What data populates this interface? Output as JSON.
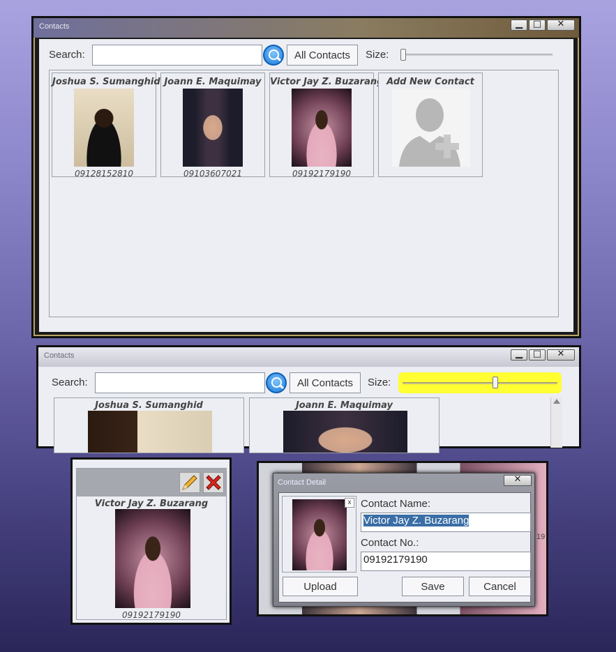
{
  "main_window": {
    "title": "Contacts",
    "search_label": "Search:",
    "search_value": "",
    "filter_button": "All Contacts",
    "size_label": "Size:",
    "size_level": 0.0,
    "contacts": [
      {
        "name": "Joshua S. Sumanghid",
        "number": "09128152810"
      },
      {
        "name": "Joann E. Maquimay",
        "number": "09103607021"
      },
      {
        "name": "Victor Jay Z. Buzarang",
        "number": "09192179190"
      }
    ],
    "add_new_label": "Add New Contact"
  },
  "zoom_window": {
    "title": "Contacts",
    "search_label": "Search:",
    "filter_button": "All Contacts",
    "size_label": "Size:",
    "size_level": 0.6,
    "contacts": [
      {
        "name": "Joshua S. Sumanghid"
      },
      {
        "name": "Joann E. Maquimay"
      }
    ]
  },
  "selected_card": {
    "name": "Victor Jay Z. Buzarang",
    "number": "09192179190"
  },
  "detail_dialog": {
    "title": "Contact Detail",
    "close_x": "x",
    "name_label": "Contact Name:",
    "name_value": "Victor Jay Z. Buzarang",
    "number_label": "Contact No.:",
    "number_value": "09192179190",
    "upload": "Upload",
    "save": "Save",
    "cancel": "Cancel",
    "bg_fragment": "19"
  },
  "colors": {
    "highlight": "#ffff33",
    "search_blue": "#1a78d8"
  }
}
